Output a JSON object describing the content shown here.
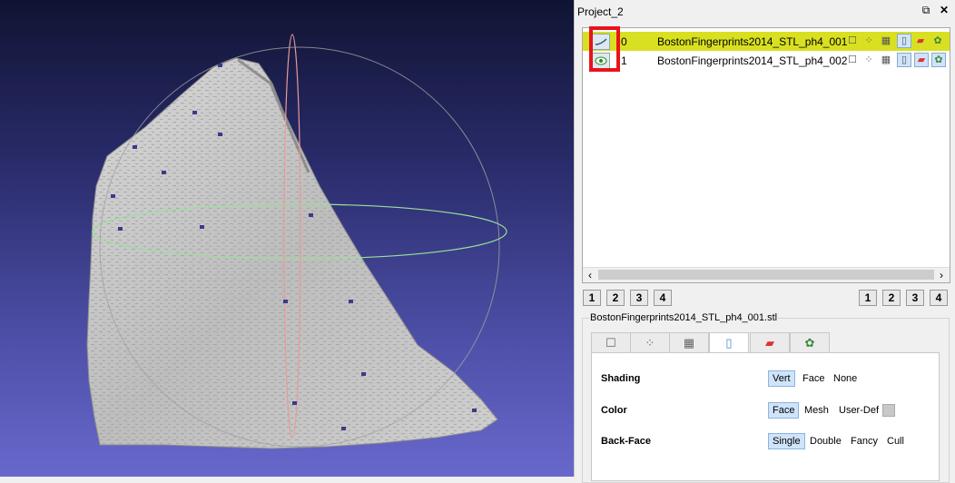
{
  "panel": {
    "title": "Project_2",
    "float_icon": "float-icon",
    "close_icon": "close-icon"
  },
  "layers": [
    {
      "index": "0",
      "name": "BostonFingerprints2014_STL_ph4_001",
      "selected": true,
      "visibility_icon": "mesh-visible-icon"
    },
    {
      "index": "1",
      "name": "BostonFingerprints2014_STL_ph4_002",
      "selected": false,
      "visibility_icon": "eye-icon"
    }
  ],
  "layer_icons": [
    "box-icon",
    "points-icon",
    "wireframe-icon",
    "flat-shade-icon",
    "texture-icon",
    "settings-icon"
  ],
  "scroll": {
    "left_arrow": "‹",
    "right_arrow": "›"
  },
  "left_buttons": [
    "1",
    "2",
    "3",
    "4"
  ],
  "right_buttons": [
    "1",
    "2",
    "3",
    "4"
  ],
  "render_group": {
    "title": "BostonFingerprints2014_STL_ph4_001.stl",
    "tabs": [
      {
        "icon": "bbox-icon",
        "glyph": "☐"
      },
      {
        "icon": "points-icon",
        "glyph": "⁘"
      },
      {
        "icon": "wireframe-icon",
        "glyph": "▦"
      },
      {
        "icon": "solid-icon",
        "glyph": "▯",
        "active": true
      },
      {
        "icon": "texture-icon",
        "glyph": "▰"
      },
      {
        "icon": "settings-icon",
        "glyph": "✿"
      }
    ],
    "shading": {
      "label": "Shading",
      "options": [
        "Vert",
        "Face",
        "None"
      ],
      "selected": "Vert"
    },
    "color": {
      "label": "Color",
      "options": [
        "Face",
        "Mesh",
        "User-Def"
      ],
      "selected": "Face"
    },
    "backface": {
      "label": "Back-Face",
      "options": [
        "Single",
        "Double",
        "Fancy",
        "Cull"
      ],
      "selected": "Single"
    }
  },
  "colors": {
    "highlight": "#d9e021",
    "viewport_top": "#101432",
    "viewport_bottom": "#6868cc",
    "annotation": "#e8141b"
  }
}
